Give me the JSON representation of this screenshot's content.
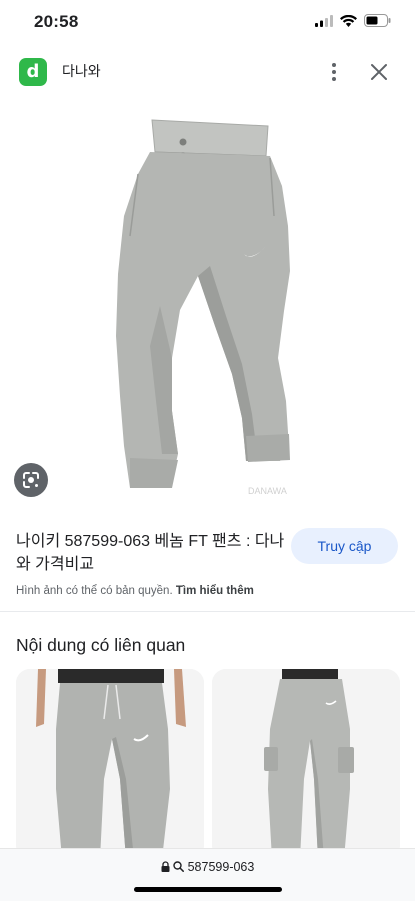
{
  "status": {
    "time": "20:58"
  },
  "header": {
    "favicon_letter": "d",
    "site_name": "다나와"
  },
  "result": {
    "title": "나이키 587599-063 베놈 FT 팬츠 : 다나와 가격비교",
    "visit_label": "Truy cập",
    "copyright_text": "Hình ảnh có thể có bản quyền.",
    "learn_more": "Tìm hiểu thêm",
    "hero_watermark": "DANAWA"
  },
  "related": {
    "heading": "Nội dung có liên quan"
  },
  "bottom": {
    "url": "587599-063"
  },
  "colors": {
    "accent_bg": "#e8f0fe",
    "accent_text": "#1a57c8",
    "favicon": "#2fb84a",
    "pants_gray": "#b4b6b3"
  },
  "icons": [
    "signal-icon",
    "wifi-icon",
    "battery-icon",
    "more-vert-icon",
    "close-icon",
    "google-lens-icon",
    "lock-icon",
    "search-icon"
  ]
}
